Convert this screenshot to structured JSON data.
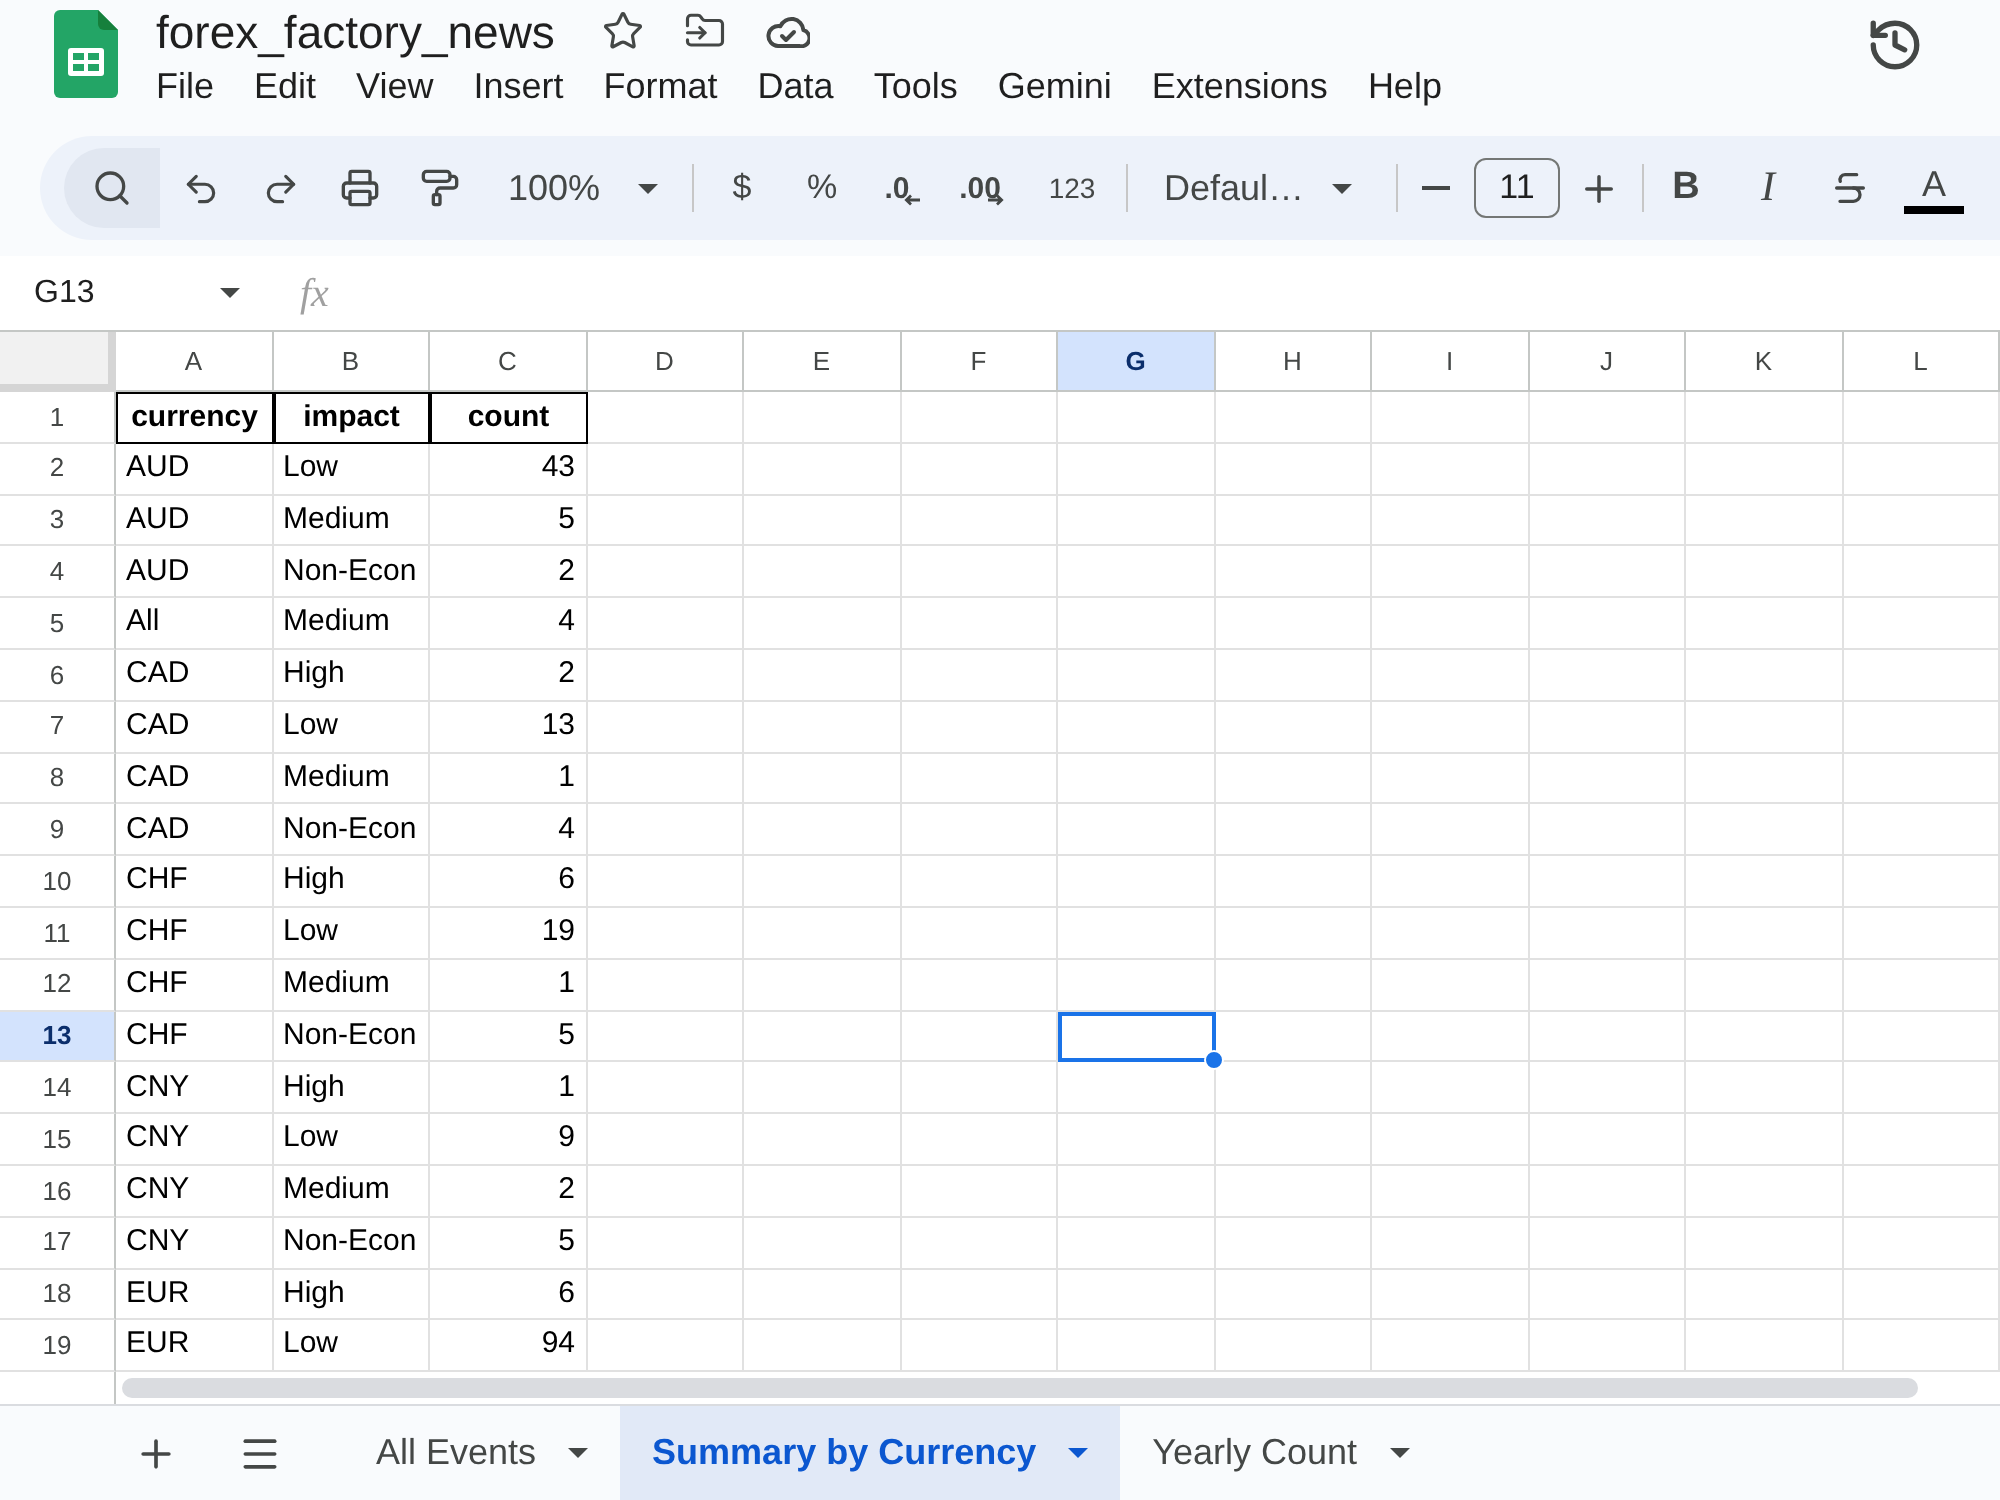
{
  "app": {
    "title": "forex_factory_news"
  },
  "menu": [
    "File",
    "Edit",
    "View",
    "Insert",
    "Format",
    "Data",
    "Tools",
    "Gemini",
    "Extensions",
    "Help"
  ],
  "toolbar": {
    "zoom": "100%",
    "currency": "$",
    "percent": "%",
    "decrease_decimals": ".0",
    "increase_decimals": ".00",
    "more_formats": "123",
    "font": "Defaul…",
    "font_size": "11",
    "bold": "B",
    "italic": "I",
    "text_color": "A"
  },
  "formula_bar": {
    "name_box": "G13",
    "function_label": "fx"
  },
  "sheet": {
    "columns": [
      {
        "label": "A",
        "selected": false
      },
      {
        "label": "B",
        "selected": false
      },
      {
        "label": "C",
        "selected": false
      },
      {
        "label": "D",
        "selected": false
      },
      {
        "label": "E",
        "selected": false
      },
      {
        "label": "F",
        "selected": false
      },
      {
        "label": "G",
        "selected": true
      },
      {
        "label": "H",
        "selected": false
      },
      {
        "label": "I",
        "selected": false
      },
      {
        "label": "J",
        "selected": false
      },
      {
        "label": "K",
        "selected": false
      },
      {
        "label": "L",
        "selected": false
      }
    ],
    "rows": [
      {
        "number": "1",
        "selected": false,
        "kind": "header",
        "cells": [
          "currency",
          "impact",
          "count"
        ]
      },
      {
        "number": "2",
        "selected": false,
        "kind": "data",
        "cells": [
          "AUD",
          "Low",
          "43"
        ]
      },
      {
        "number": "3",
        "selected": false,
        "kind": "data",
        "cells": [
          "AUD",
          "Medium",
          "5"
        ]
      },
      {
        "number": "4",
        "selected": false,
        "kind": "data",
        "cells": [
          "AUD",
          "Non-Econ",
          "2"
        ]
      },
      {
        "number": "5",
        "selected": false,
        "kind": "data",
        "cells": [
          "All",
          "Medium",
          "4"
        ]
      },
      {
        "number": "6",
        "selected": false,
        "kind": "data",
        "cells": [
          "CAD",
          "High",
          "2"
        ]
      },
      {
        "number": "7",
        "selected": false,
        "kind": "data",
        "cells": [
          "CAD",
          "Low",
          "13"
        ]
      },
      {
        "number": "8",
        "selected": false,
        "kind": "data",
        "cells": [
          "CAD",
          "Medium",
          "1"
        ]
      },
      {
        "number": "9",
        "selected": false,
        "kind": "data",
        "cells": [
          "CAD",
          "Non-Econ",
          "4"
        ]
      },
      {
        "number": "10",
        "selected": false,
        "kind": "data",
        "cells": [
          "CHF",
          "High",
          "6"
        ]
      },
      {
        "number": "11",
        "selected": false,
        "kind": "data",
        "cells": [
          "CHF",
          "Low",
          "19"
        ]
      },
      {
        "number": "12",
        "selected": false,
        "kind": "data",
        "cells": [
          "CHF",
          "Medium",
          "1"
        ]
      },
      {
        "number": "13",
        "selected": true,
        "kind": "data",
        "cells": [
          "CHF",
          "Non-Econ",
          "5"
        ]
      },
      {
        "number": "14",
        "selected": false,
        "kind": "data",
        "cells": [
          "CNY",
          "High",
          "1"
        ]
      },
      {
        "number": "15",
        "selected": false,
        "kind": "data",
        "cells": [
          "CNY",
          "Low",
          "9"
        ]
      },
      {
        "number": "16",
        "selected": false,
        "kind": "data",
        "cells": [
          "CNY",
          "Medium",
          "2"
        ]
      },
      {
        "number": "17",
        "selected": false,
        "kind": "data",
        "cells": [
          "CNY",
          "Non-Econ",
          "5"
        ]
      },
      {
        "number": "18",
        "selected": false,
        "kind": "data",
        "cells": [
          "EUR",
          "High",
          "6"
        ]
      },
      {
        "number": "19",
        "selected": false,
        "kind": "data",
        "cells": [
          "EUR",
          "Low",
          "94"
        ]
      }
    ]
  },
  "sheet_tabs": [
    {
      "label": "All Events",
      "selected": false
    },
    {
      "label": "Summary by Currency",
      "selected": true
    },
    {
      "label": "Yearly Count",
      "selected": false
    }
  ]
}
